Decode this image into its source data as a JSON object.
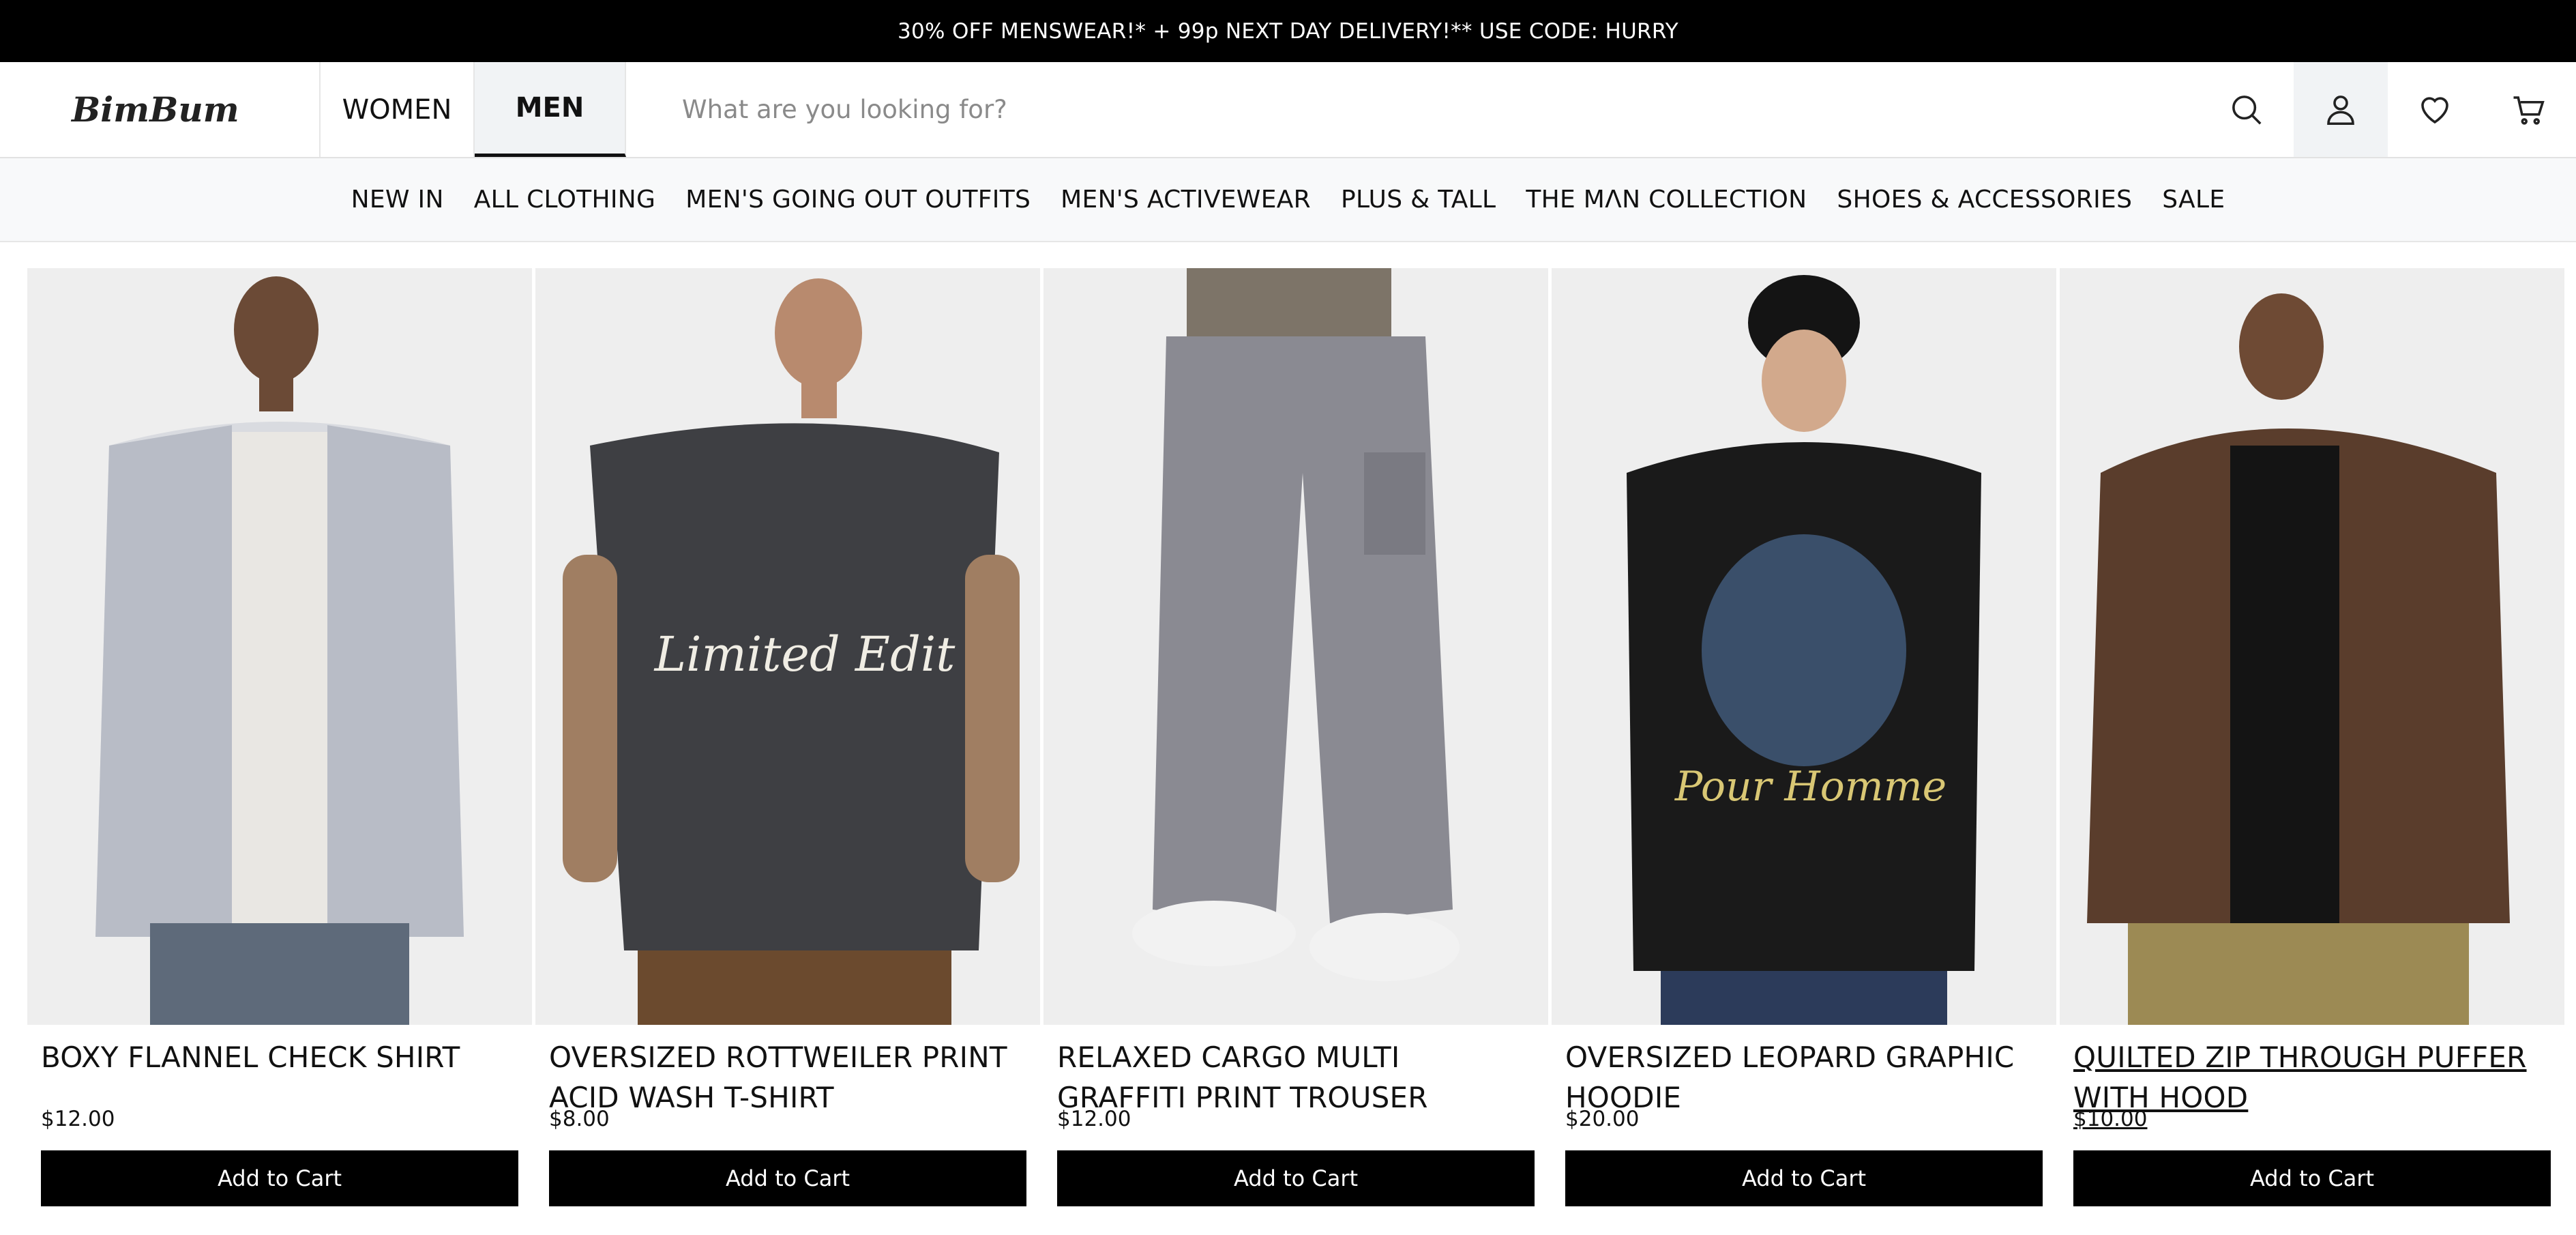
{
  "promo_banner": "30% OFF MENSWEAR!* + 99p NEXT DAY DELIVERY!** USE CODE: HURRY",
  "header": {
    "logo": "BimBum",
    "tabs": [
      "WOMEN",
      "MEN"
    ],
    "active_tab": "MEN",
    "search_placeholder": "What are you looking for?"
  },
  "nav": [
    "NEW IN",
    "ALL CLOTHING",
    "MEN'S GOING OUT OUTFITS",
    "MEN'S ACTIVEWEAR",
    "PLUS & TALL",
    "THE MΛN COLLECTION",
    "SHOES & ACCESSORIES",
    "SALE"
  ],
  "products": [
    {
      "title": "BOXY FLANNEL CHECK SHIRT",
      "price": "$12.00",
      "button": "Add to Cart"
    },
    {
      "title": "OVERSIZED ROTTWEILER PRINT ACID WASH T-SHIRT",
      "price": "$8.00",
      "button": "Add to Cart"
    },
    {
      "title": "RELAXED CARGO MULTI GRAFFITI PRINT TROUSER",
      "price": "$12.00",
      "button": "Add to Cart"
    },
    {
      "title": "OVERSIZED LEOPARD GRAPHIC HOODIE",
      "price": "$20.00",
      "button": "Add to Cart"
    },
    {
      "title": "QUILTED ZIP THROUGH PUFFER WITH HOOD",
      "price": "$10.00",
      "button": "Add to Cart"
    }
  ],
  "icons": [
    "search-icon",
    "account-icon",
    "wishlist-icon",
    "cart-icon"
  ],
  "colors": {
    "banner_bg": "#000000",
    "button_bg": "#000000",
    "nav_bg": "#f8f9fa",
    "image_bg": "#eeeeee"
  }
}
